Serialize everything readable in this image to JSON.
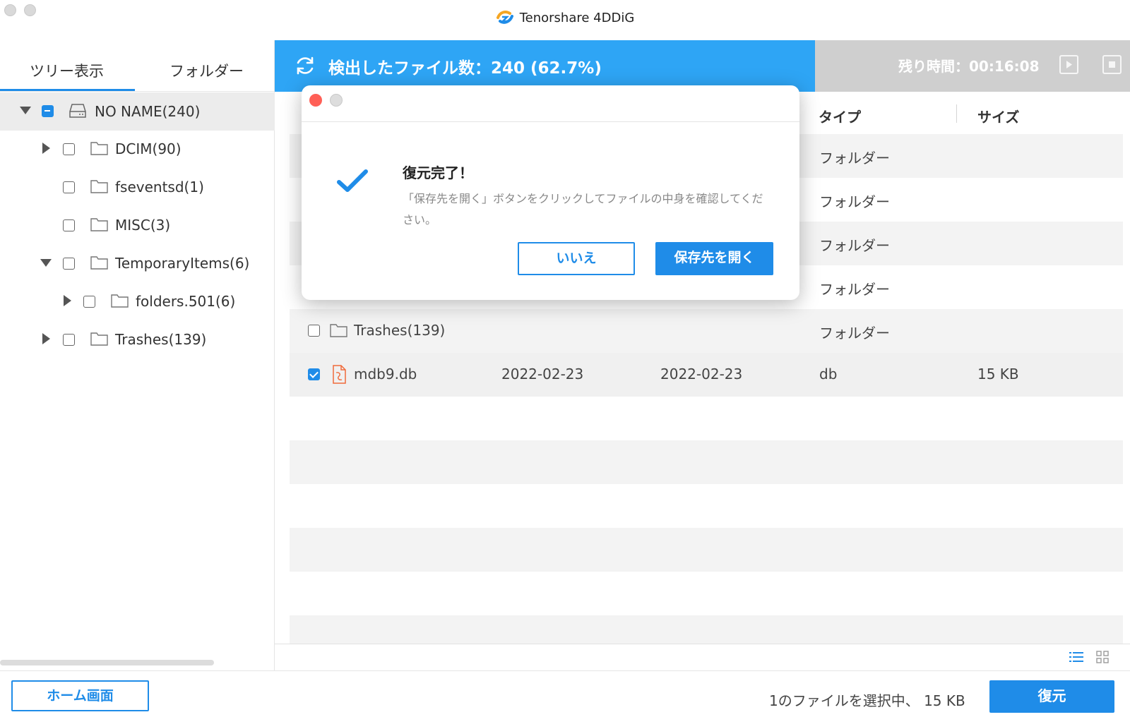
{
  "app": {
    "title": "Tenorshare 4DDiG"
  },
  "sidebar": {
    "tabs": [
      "ツリー表示",
      "フォルダー"
    ],
    "tree": [
      {
        "label": "NO NAME(240)"
      },
      {
        "label": "DCIM(90)"
      },
      {
        "label": "fseventsd(1)"
      },
      {
        "label": "MISC(3)"
      },
      {
        "label": "TemporaryItems(6)"
      },
      {
        "label": "folders.501(6)"
      },
      {
        "label": "Trashes(139)"
      }
    ]
  },
  "scan": {
    "status": "検出したファイル数：240 (62.7%)",
    "remaining": "残り時間：00:16:08"
  },
  "table": {
    "headers": {
      "type": "タイプ",
      "size": "サイズ"
    },
    "rows": [
      {
        "type": "フォルダー"
      },
      {
        "type": "フォルダー"
      },
      {
        "type": "フォルダー"
      },
      {
        "type": "フォルダー"
      },
      {
        "name": "Trashes(139)",
        "type": "フォルダー"
      },
      {
        "name": "mdb9.db",
        "created": "2022-02-23",
        "modified": "2022-02-23",
        "type": "db",
        "size": "15 KB"
      }
    ]
  },
  "footer": {
    "home_label": "ホーム画面",
    "status": "1のファイルを選択中、 15 KB",
    "restore_label": "復元"
  },
  "dialog": {
    "title": "復元完了！",
    "message": "「保存先を開く」ボタンをクリックしてファイルの中身を確認してください。",
    "no_label": "いいえ",
    "open_label": "保存先を開く"
  },
  "colors": {
    "accent": "#1f8ce8",
    "scan_bar": "#2ea5f5",
    "file_icon": "#f06a3a"
  }
}
